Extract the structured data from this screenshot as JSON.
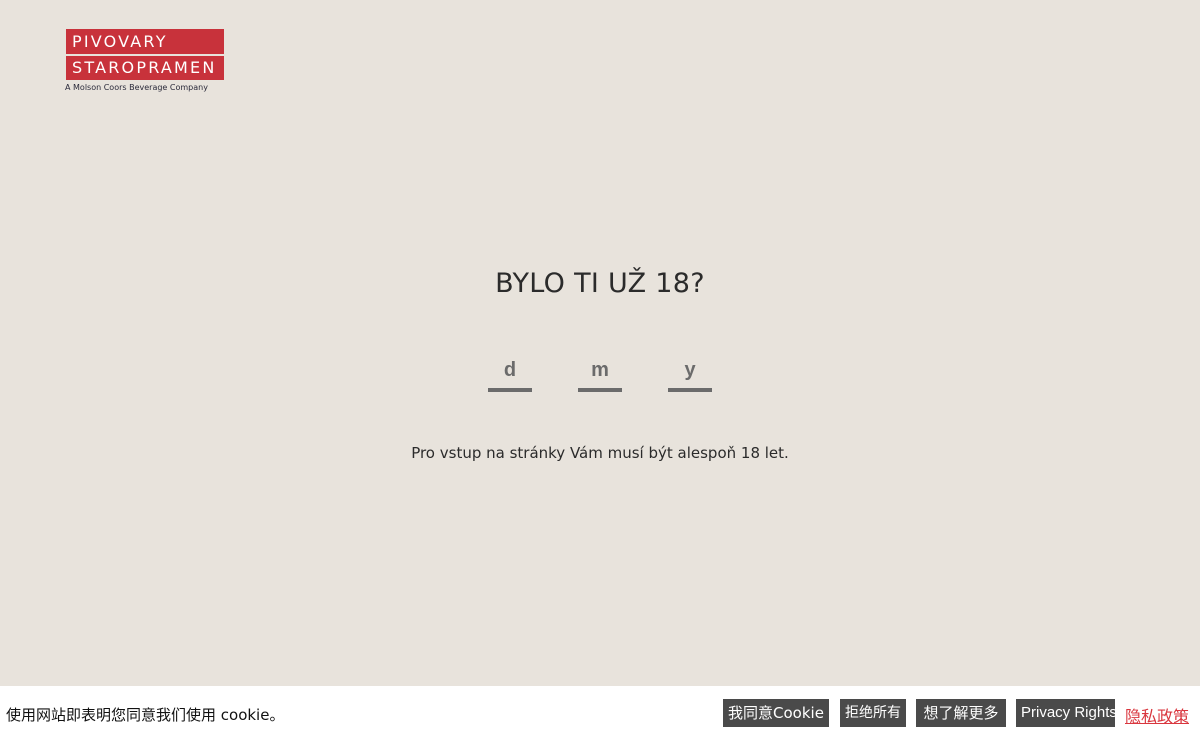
{
  "logo": {
    "line1": "PIVOVARY",
    "line2": "STAROPRAMEN",
    "tagline": "A Molson Coors Beverage Company",
    "brand_color": "#c8323b"
  },
  "age_gate": {
    "question": "BYLO TI UŽ 18?",
    "day_placeholder": "d",
    "month_placeholder": "m",
    "year_placeholder": "y",
    "notice": "Pro vstup na stránky Vám musí být alespoň 18 let."
  },
  "cookie_bar": {
    "text": "使用网站即表明您同意我们使用 cookie。",
    "accept_label": "我同意Cookie",
    "reject_label": "拒绝所有",
    "learn_more_label": "想了解更多",
    "privacy_rights_label": "Privacy Rights",
    "privacy_policy_label": "隐私政策",
    "button_color": "#4a4a4a",
    "link_color": "#d9363e"
  },
  "colors": {
    "background": "#e8e3dc"
  }
}
